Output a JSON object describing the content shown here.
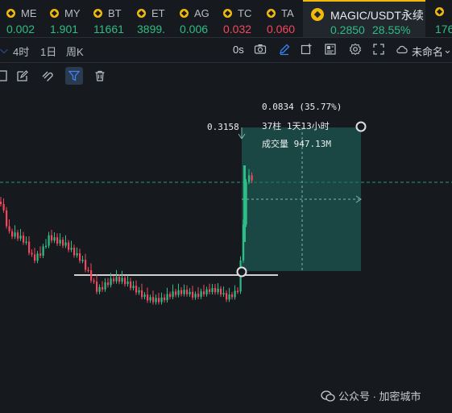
{
  "tickers": [
    {
      "symbol": "ME",
      "value": "0.002",
      "dir": "up"
    },
    {
      "symbol": "MY",
      "value": "1.901",
      "dir": "up"
    },
    {
      "symbol": "BT",
      "value": "11661",
      "dir": "up"
    },
    {
      "symbol": "ET",
      "value": "3899.",
      "dir": "up"
    },
    {
      "symbol": "AG",
      "value": "0.006",
      "dir": "up"
    },
    {
      "symbol": "TC",
      "value": "0.032",
      "dir": "down"
    },
    {
      "symbol": "TA",
      "value": "0.060",
      "dir": "down"
    }
  ],
  "active_ticker": {
    "symbol": "MAGIC/USDT永续",
    "price": "0.2850",
    "change": "28.55%"
  },
  "right_ticker_value": "176",
  "toolbar": {
    "timeframes": [
      "4时",
      "1日",
      "周K"
    ],
    "replay_label": "0s",
    "layout_name": "未命名"
  },
  "measure": {
    "change": "0.0834 (35.77%)",
    "bars_time": "37柱 1天13小时",
    "volume": "成交量 947.13M"
  },
  "price_label": "0.3158",
  "watermark": "公众号 · 加密城市",
  "colors": {
    "up": "#2ebd85",
    "down": "#f6465d",
    "accent": "#f0b90b",
    "selected": "#3b82f6"
  }
}
